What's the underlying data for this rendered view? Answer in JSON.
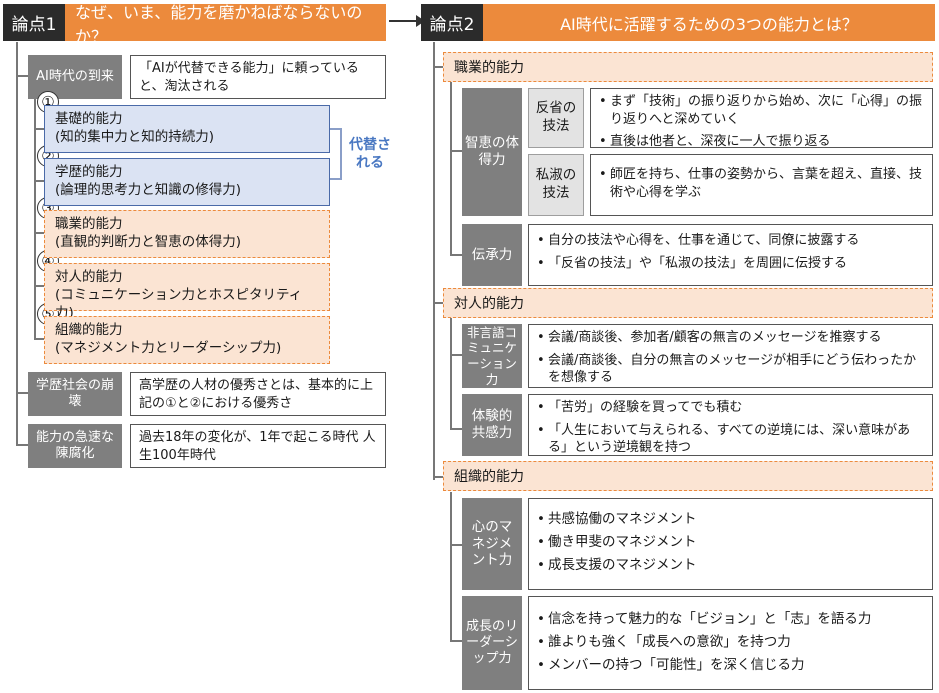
{
  "left": {
    "tag": "論点1",
    "title": "なぜ、いま、能力を磨かねばならないのか？",
    "ai_era": {
      "label": "AI時代の到来",
      "text": "「AIが代替できる能力」に頼っていると、淘汰される"
    },
    "numbers": [
      "①",
      "②",
      "③",
      "④",
      "⑤"
    ],
    "abilities": [
      {
        "name": "基礎的能力",
        "detail": "(知的集中力と知的持続力)"
      },
      {
        "name": "学歴的能力",
        "detail": "(論理的思考力と知識の修得力)"
      },
      {
        "name": "職業的能力",
        "detail": "(直観的判断力と智恵の体得力)"
      },
      {
        "name": "対人的能力",
        "detail": "(コミュニケーション力とホスピタリティ力)"
      },
      {
        "name": "組織的能力",
        "detail": "(マネジメント力とリーダーシップ力)"
      }
    ],
    "replaced_note": "代替される",
    "education_society": {
      "label": "学歴社会の崩壊",
      "text": "高学歴の人材の優秀さとは、基本的に上記の①と②における優秀さ"
    },
    "obsolescence": {
      "label": "能力の急速な陳腐化",
      "text": "過去18年の変化が、1年で起こる時代 人生100年時代"
    }
  },
  "right": {
    "tag": "論点2",
    "title": "AI時代に活躍するための3つの能力とは？",
    "professional": {
      "section": "職業的能力",
      "wisdom_label": "智恵の体得力",
      "reflection_label": "反省の技法",
      "reflection_points": [
        "まず「技術」の振り返りから始め、次に「心得」の振り返りへと深めていく",
        "直後は他者と、深夜に一人で振り返る"
      ],
      "apprentice_label": "私淑の技法",
      "apprentice_points": [
        "師匠を持ち、仕事の姿勢から、言葉を超え、直接、技術や心得を学ぶ"
      ],
      "transmission_label": "伝承力",
      "transmission_points": [
        "自分の技法や心得を、仕事を通じて、同僚に披露する",
        "「反省の技法」や「私淑の技法」を周囲に伝授する"
      ]
    },
    "interpersonal": {
      "section": "対人的能力",
      "nonverbal_label": "非言語コミュニケーション力",
      "nonverbal_points": [
        "会議/商談後、参加者/顧客の無言のメッセージを推察する",
        "会議/商談後、自分の無言のメッセージが相手にどう伝わったかを想像する"
      ],
      "empathy_label": "体験的共感力",
      "empathy_points": [
        "「苦労」の経験を買ってでも積む",
        "「人生において与えられる、すべての逆境には、深い意味がある」という逆境観を持つ"
      ]
    },
    "organizational": {
      "section": "組織的能力",
      "management_label": "心のマネジメント力",
      "management_points": [
        "共感協働のマネジメント",
        "働き甲斐のマネジメント",
        "成長支援のマネジメント"
      ],
      "leadership_label": "成長のリーダーシップ力",
      "leadership_points": [
        "信念を持って魅力的な「ビジョン」と「志」を語る力",
        "誰よりも強く「成長への意欲」を持つ力",
        "メンバーの持つ「可能性」を深く信じる力"
      ]
    }
  },
  "colors": {
    "accent": "#ec8a3c",
    "dark": "#2b2b2b",
    "gray": "#7f7f7f",
    "blue_fill": "#dbe3f3",
    "peach_fill": "#fbe4d3",
    "blue_text": "#4a78c2"
  }
}
